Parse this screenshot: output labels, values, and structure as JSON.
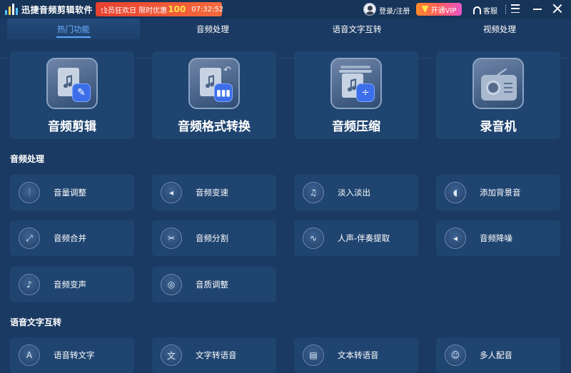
{
  "titlebar": {
    "app_title": "迅捷音频剪辑软件",
    "promo_text": "会员狂欢日 限时优惠",
    "promo_percent": "100",
    "promo_timer": "07:32:52",
    "login_label": "登录/注册",
    "vip_label": "开通VIP",
    "service_label": "客服"
  },
  "tabs": [
    {
      "label": "热门功能",
      "active": true
    },
    {
      "label": "音频处理",
      "active": false
    },
    {
      "label": "语音文字互转",
      "active": false
    },
    {
      "label": "视频处理",
      "active": false
    }
  ],
  "featured": [
    {
      "label": "音频剪辑",
      "icon": "audio-edit-icon"
    },
    {
      "label": "音频格式转换",
      "icon": "audio-convert-icon"
    },
    {
      "label": "音频压缩",
      "icon": "audio-compress-icon"
    },
    {
      "label": "录音机",
      "icon": "recorder-icon"
    }
  ],
  "sections": {
    "audio_processing": {
      "title": "音频处理",
      "items": [
        {
          "label": "音量调整",
          "icon": "volume-sliders-icon",
          "glyph": "⫶"
        },
        {
          "label": "音频变速",
          "icon": "speed-icon",
          "glyph": "◂"
        },
        {
          "label": "淡入淡出",
          "icon": "fade-icon",
          "glyph": "♫"
        },
        {
          "label": "添加背景音",
          "icon": "background-music-icon",
          "glyph": "◖"
        },
        {
          "label": "音频合并",
          "icon": "merge-icon",
          "glyph": "⤢"
        },
        {
          "label": "音频分割",
          "icon": "scissors-icon",
          "glyph": "✂"
        },
        {
          "label": "人声-伴奏提取",
          "icon": "waveform-icon",
          "glyph": "∿"
        },
        {
          "label": "音频降噪",
          "icon": "denoise-icon",
          "glyph": "◂"
        },
        {
          "label": "音频变声",
          "icon": "voice-change-icon",
          "glyph": "♪"
        },
        {
          "label": "音质调整",
          "icon": "quality-icon",
          "glyph": "◎"
        }
      ]
    },
    "speech_text": {
      "title": "语音文字互转",
      "items": [
        {
          "label": "语音转文字",
          "icon": "speech-to-text-icon",
          "glyph": "A"
        },
        {
          "label": "文字转语音",
          "icon": "text-to-speech-icon",
          "glyph": "文"
        },
        {
          "label": "文本转语音",
          "icon": "document-to-speech-icon",
          "glyph": "▤"
        },
        {
          "label": "多人配音",
          "icon": "multi-voice-icon",
          "glyph": "☺"
        }
      ]
    }
  },
  "colors": {
    "background": "#1b3a63",
    "card": "#1f4470",
    "active_tab": "#6db1ff",
    "promo": "#e8402f",
    "accent_blue": "#3b6ee8"
  }
}
